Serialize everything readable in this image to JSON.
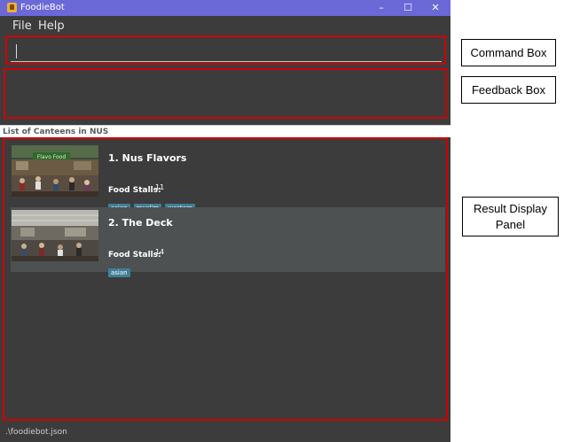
{
  "window": {
    "title": "FoodieBot",
    "controls": {
      "minimize": "–",
      "maximize": "☐",
      "close": "✕"
    }
  },
  "menu": {
    "file": "File",
    "help": "Help"
  },
  "command_box": {
    "value": "",
    "placeholder": ""
  },
  "feedback_box": {
    "text": ""
  },
  "list_header": "List of Canteens in NUS",
  "canteens": [
    {
      "index_name": "1.  Nus Flavors",
      "stalls_label": "Food Stalls:",
      "stalls_count": "11",
      "tags": [
        "asian",
        "muslim",
        "western"
      ]
    },
    {
      "index_name": "2.  The Deck",
      "stalls_label": "Food Stalls:",
      "stalls_count": "14",
      "tags": [
        "asian"
      ]
    }
  ],
  "status_bar": {
    "path": ".\\foodiebot.json"
  },
  "annotations": {
    "command_box": "Command Box",
    "feedback_box": "Feedback Box",
    "result_display": "Result Display Panel"
  },
  "colors": {
    "titlebar": "#6b68d8",
    "window_bg": "#3c3c3c",
    "highlight": "#d00000",
    "tag_bg": "#3f7f99"
  },
  "icons": {
    "app": "foodiebot-app-icon"
  }
}
